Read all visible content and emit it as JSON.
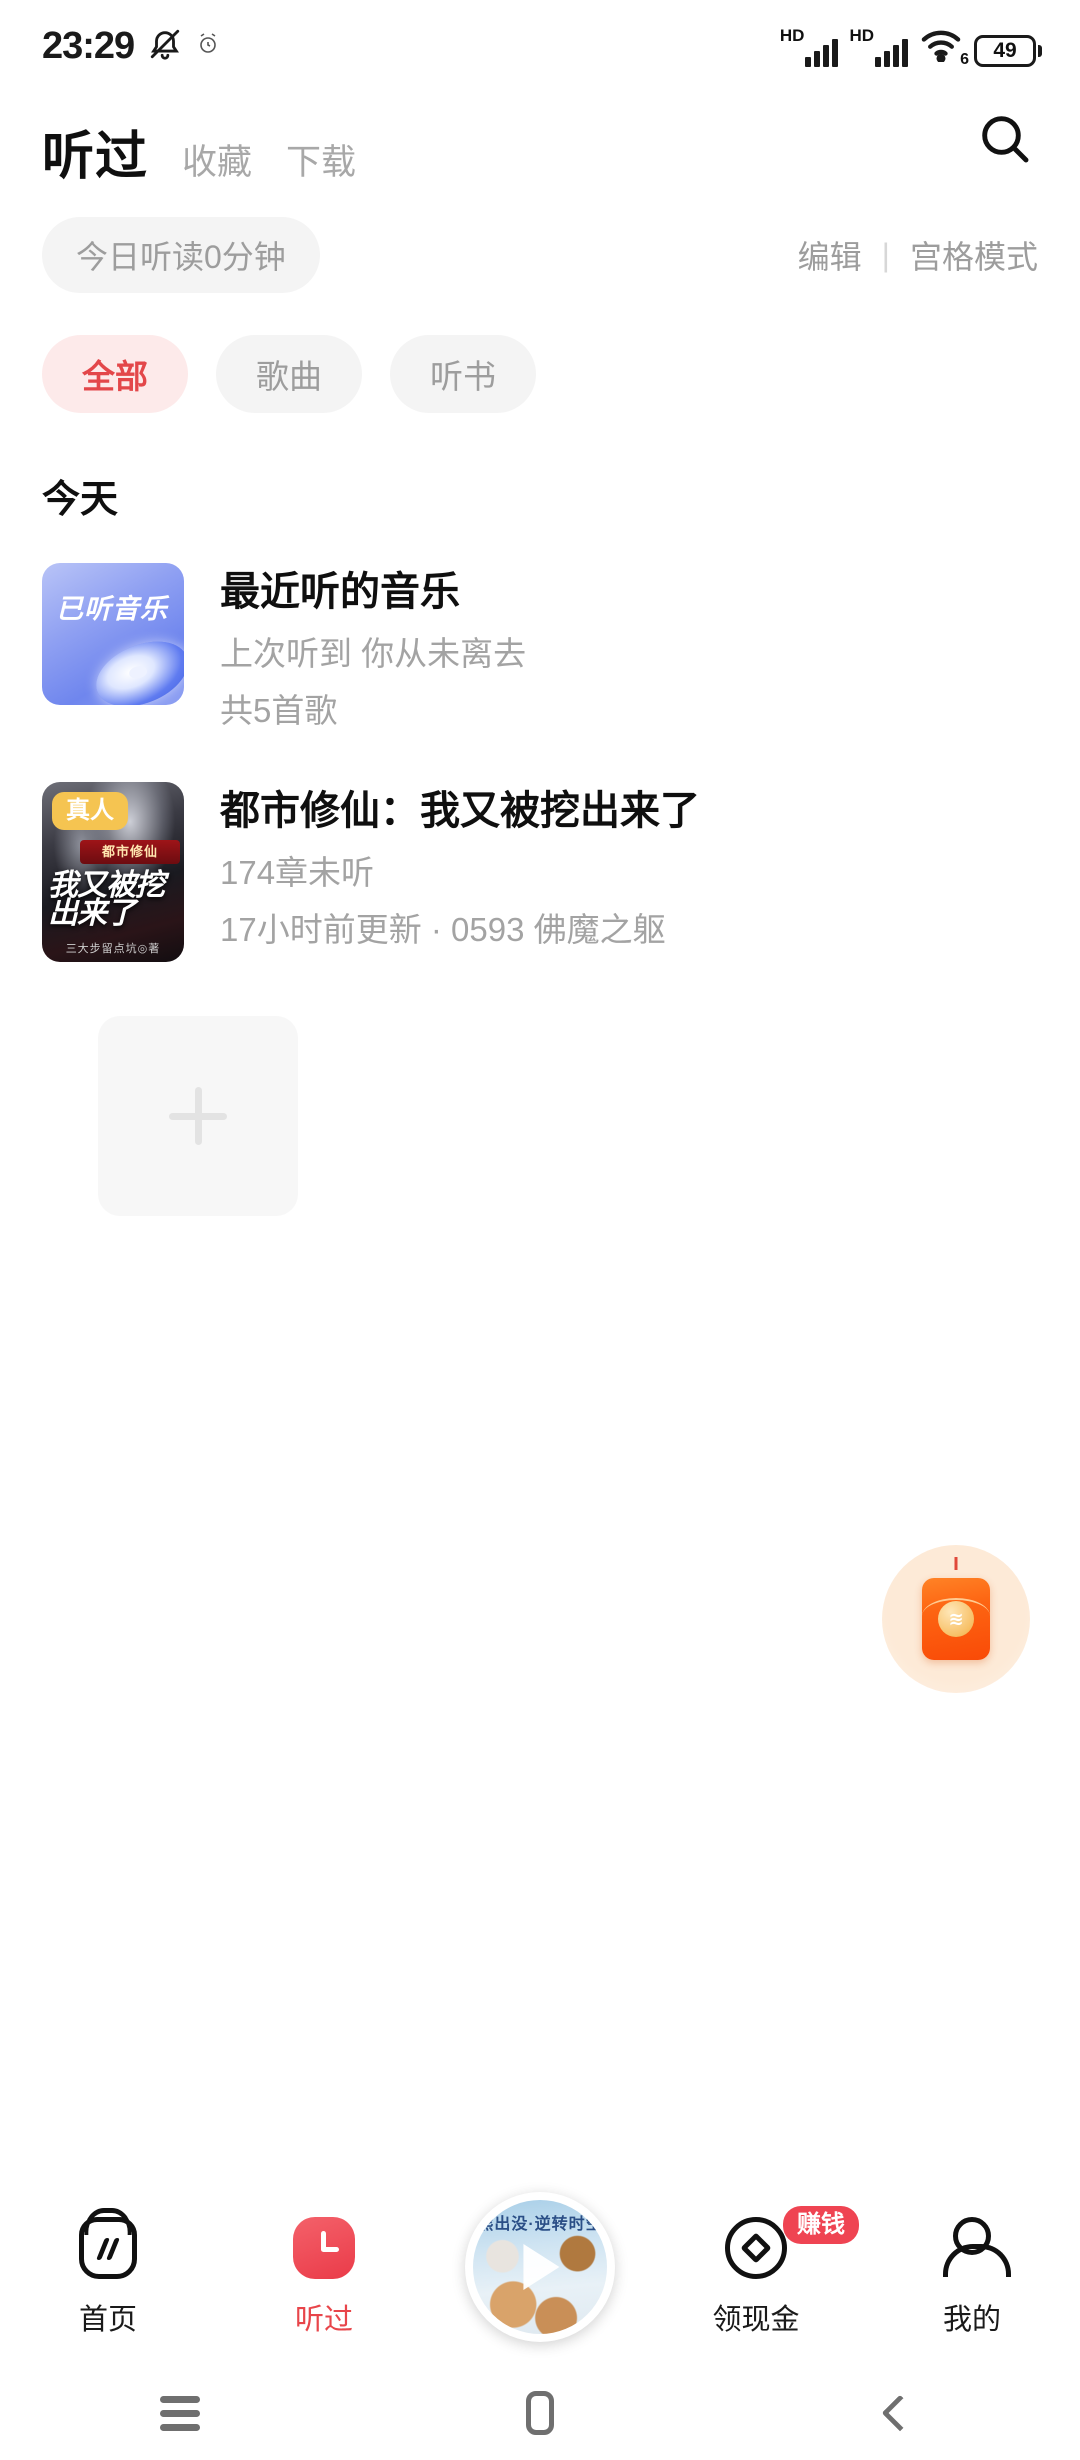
{
  "status_bar": {
    "time": "23:29",
    "icons": [
      "silent-bell-icon",
      "alarm-icon"
    ],
    "network": [
      {
        "label": "HD",
        "name": "hd-signal-1"
      },
      {
        "label": "HD",
        "name": "hd-signal-2"
      }
    ],
    "wifi": "wifi-6-icon",
    "wifi_generation": "6",
    "battery": "49"
  },
  "header": {
    "title": "听过",
    "tabs": [
      {
        "label": "收藏",
        "active": false
      },
      {
        "label": "下载",
        "active": false
      }
    ],
    "search_icon": "search-icon"
  },
  "subheader": {
    "minutes_pill": "今日听读0分钟",
    "edit": "编辑",
    "separator": "|",
    "grid_mode": "宫格模式"
  },
  "filters": [
    {
      "label": "全部",
      "active": true
    },
    {
      "label": "歌曲",
      "active": false
    },
    {
      "label": "听书",
      "active": false
    }
  ],
  "section": {
    "label": "今天"
  },
  "items": [
    {
      "type": "music",
      "thumb_label": "已听音乐",
      "title": "最近听的音乐",
      "line2": "上次听到 你从未离去",
      "line3": "共5首歌"
    },
    {
      "type": "book",
      "badge": "真人",
      "cover_banner": "都市修仙",
      "cover_title": "我又被挖出来了",
      "cover_author": "三大步留点坑◎著",
      "title": "都市修仙：我又被挖出来了",
      "line2": "174章未听",
      "line3": "17小时前更新 · 0593  佛魔之躯"
    }
  ],
  "add_card": {
    "icon": "plus-icon"
  },
  "floating": {
    "hongbao": {
      "name": "red-packet-icon",
      "seal_glyph": "≋"
    }
  },
  "bottom_nav": [
    {
      "label": "首页",
      "icon": "home-icon",
      "active": false
    },
    {
      "label": "听过",
      "icon": "history-clock-icon",
      "active": true
    },
    {
      "label": "",
      "icon": "player-play-icon",
      "active": false,
      "art_title": "熊出没·逆转时空"
    },
    {
      "label": "领现金",
      "icon": "coin-icon",
      "active": false,
      "badge": "赚钱"
    },
    {
      "label": "我的",
      "icon": "person-icon",
      "active": false
    }
  ],
  "android_nav": [
    {
      "name": "recents-button",
      "icon": "menu-icon"
    },
    {
      "name": "home-button",
      "icon": "square-icon"
    },
    {
      "name": "back-button",
      "icon": "chevron-left-icon"
    }
  ],
  "colors": {
    "accent_red": "#e8454a",
    "chip_active_bg": "#fdeaea",
    "muted": "#a3a3a3"
  }
}
